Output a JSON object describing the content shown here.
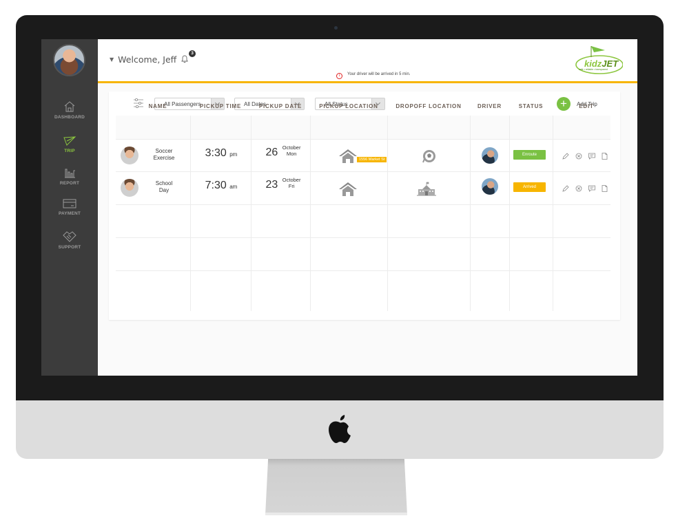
{
  "sidebar": {
    "items": [
      {
        "label": "DASHBOARD",
        "icon": "home-icon",
        "active": false
      },
      {
        "label": "TRIP",
        "icon": "paper-plane-icon",
        "active": true
      },
      {
        "label": "REPORT",
        "icon": "bar-chart-icon",
        "active": false
      },
      {
        "label": "PAYMENT",
        "icon": "credit-card-icon",
        "active": false
      },
      {
        "label": "SUPPORT",
        "icon": "handshake-icon",
        "active": false
      }
    ]
  },
  "header": {
    "welcome": "Welcome, Jeff",
    "notification_count": "3",
    "notice": "Your driver will be arrived in 5 min.",
    "logo": {
      "text_a": "kidz",
      "text_b": "JET",
      "tagline": "safe • reliable • transparent"
    }
  },
  "filters": {
    "passengers": "All Passengers",
    "dates": "All Dates",
    "status": "All Status"
  },
  "add_trip_label": "Add Trip",
  "table": {
    "headers": [
      "NAME",
      "PICKUP TIME",
      "PICKUP DATE",
      "PICKUP LOCATION",
      "DROPOFF LOCATION",
      "DRIVER",
      "STATUS",
      "EDIT"
    ],
    "rows": [
      {
        "name_1": "Soccer",
        "name_2": "Exercise",
        "time": "3:30",
        "ampm": "pm",
        "day": "26",
        "month": "October",
        "weekday": "Mon",
        "pickup_tag": "1556 Market St",
        "dropoff_icon": "soccer-ball-icon",
        "status": "Enroute",
        "status_color": "#7ac143"
      },
      {
        "name_1": "School",
        "name_2": "Day",
        "time": "7:30",
        "ampm": "am",
        "day": "23",
        "month": "October",
        "weekday": "Fri",
        "pickup_tag": "",
        "dropoff_icon": "school-building-icon",
        "status": "Arrived",
        "status_color": "#f7b500"
      }
    ]
  },
  "colors": {
    "accent_green": "#8cc63f",
    "accent_yellow": "#f7b500",
    "sidebar_bg": "#3c3c3c"
  }
}
